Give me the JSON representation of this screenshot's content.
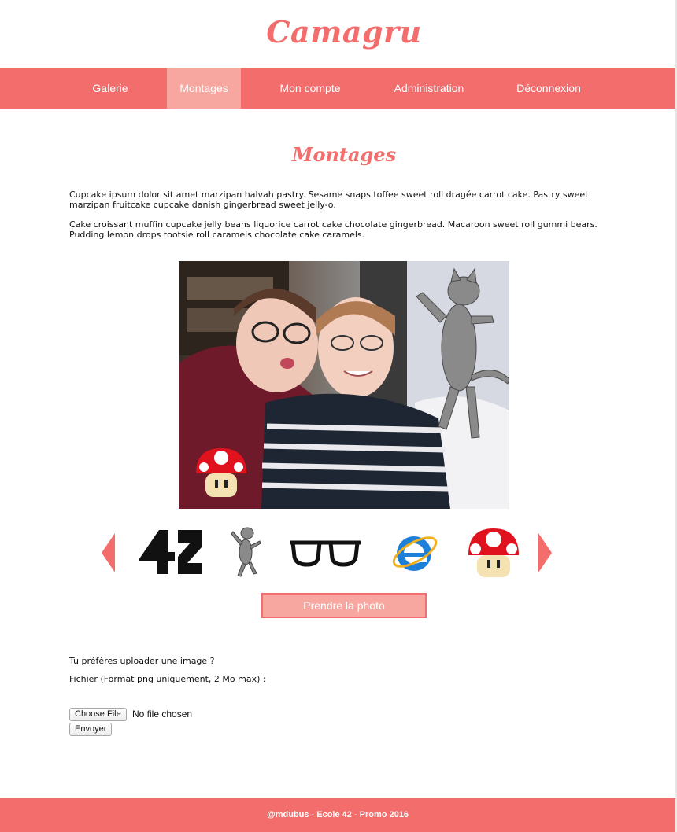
{
  "site": {
    "title": "Camagru"
  },
  "nav": {
    "items": [
      {
        "label": "Galerie",
        "active": false
      },
      {
        "label": "Montages",
        "active": true
      },
      {
        "label": "Mon compte",
        "active": false
      },
      {
        "label": "Administration",
        "active": false
      },
      {
        "label": "Déconnexion",
        "active": false
      }
    ]
  },
  "main": {
    "heading": "Montages",
    "paragraphs": [
      "Cupcake ipsum dolor sit amet marzipan halvah pastry. Sesame snaps toffee sweet roll dragée carrot cake. Pastry sweet marzipan fruitcake cupcake danish gingerbread sweet jelly-o.",
      "Cake croissant muffin cupcake jelly beans liquorice carrot cake chocolate gingerbread. Macaroon sweet roll gummi bears. Pudding lemon drops tootsie roll caramels chocolate cake caramels."
    ],
    "filters": [
      "42-logo-icon",
      "cat-icon",
      "glasses-icon",
      "internet-explorer-icon",
      "mushroom-icon"
    ],
    "take_photo_label": "Prendre la photo"
  },
  "upload": {
    "prompt": "Tu préfères uploader une image ?",
    "file_label": "Fichier (Format png uniquement, 2 Mo max) :",
    "choose_file_label": "Choose File",
    "file_status": "No file chosen",
    "submit_label": "Envoyer"
  },
  "footer": {
    "text": "@mdubus - Ecole 42 - Promo 2016"
  },
  "colors": {
    "accent": "#f36d6d",
    "accent_light": "#f8a6a0"
  }
}
